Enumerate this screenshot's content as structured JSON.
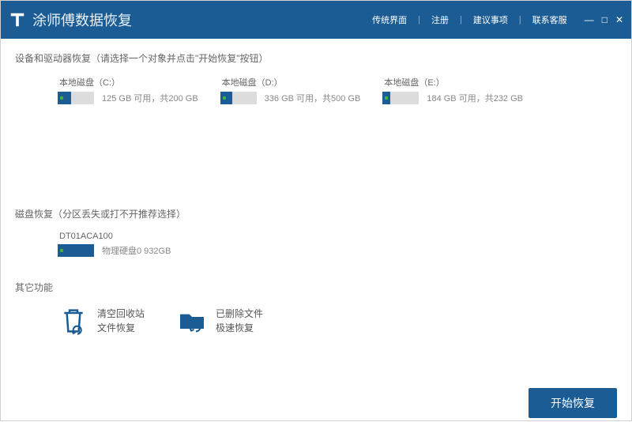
{
  "app": {
    "title": "涂师傅数据恢复"
  },
  "titlebar": {
    "links": [
      "传统界面",
      "注册",
      "建议事项",
      "联系客服"
    ]
  },
  "sections": {
    "drives_title": "设备和驱动器恢复（请选择一个对象并点击\"开始恢复\"按钮）",
    "disks_title": "磁盘恢复（分区丢失或打不开推荐选择）",
    "other_title": "其它功能"
  },
  "drives": [
    {
      "name": "本地磁盘（C:）",
      "info": "125 GB 可用，共200 GB",
      "fill": 38
    },
    {
      "name": "本地磁盘（D:）",
      "info": "336 GB 可用，共500 GB",
      "fill": 33
    },
    {
      "name": "本地磁盘（E:）",
      "info": "184 GB 可用，共232 GB",
      "fill": 21
    }
  ],
  "disks": [
    {
      "name": "DT01ACA100",
      "info": "物理硬盘0 932GB",
      "fill": 100
    }
  ],
  "other": [
    {
      "line1": "清空回收站",
      "line2": "文件恢复"
    },
    {
      "line1": "已删除文件",
      "line2": "极速恢复"
    }
  ],
  "footer": {
    "start": "开始恢复"
  }
}
